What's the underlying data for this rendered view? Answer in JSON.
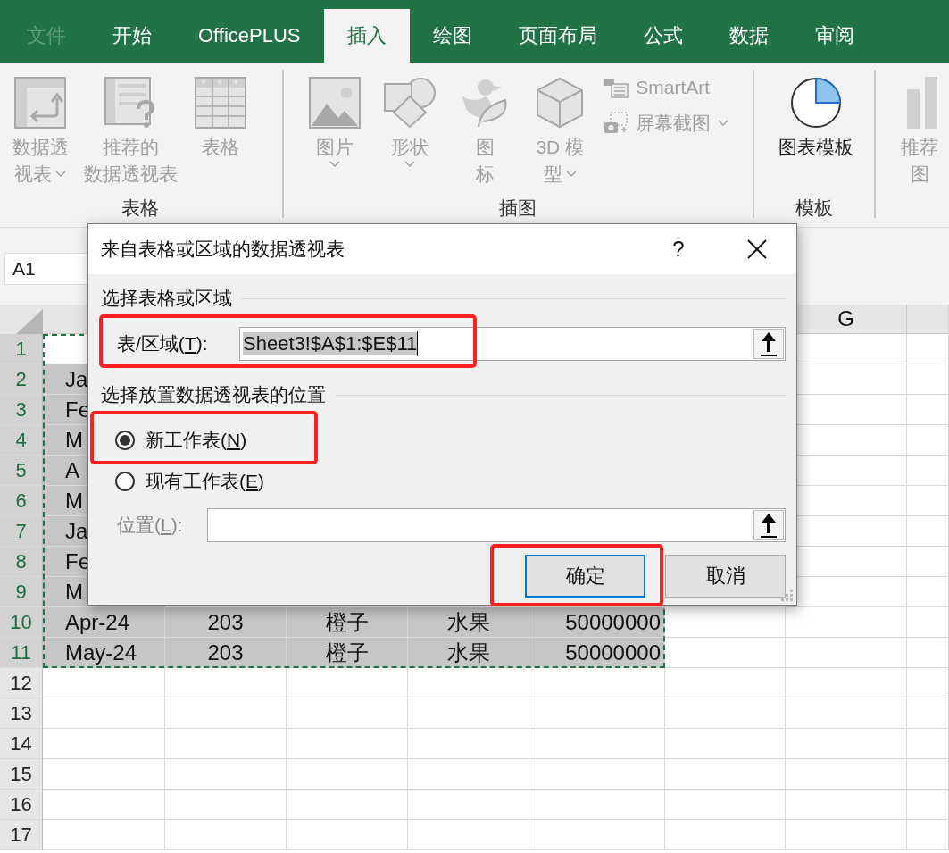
{
  "tabs": [
    {
      "label": "文件",
      "selected": false,
      "disabled": true
    },
    {
      "label": "开始",
      "selected": false,
      "disabled": false
    },
    {
      "label": "OfficePLUS",
      "selected": false,
      "disabled": false
    },
    {
      "label": "插入",
      "selected": true,
      "disabled": false
    },
    {
      "label": "绘图",
      "selected": false,
      "disabled": false
    },
    {
      "label": "页面布局",
      "selected": false,
      "disabled": false
    },
    {
      "label": "公式",
      "selected": false,
      "disabled": false
    },
    {
      "label": "数据",
      "selected": false,
      "disabled": false
    },
    {
      "label": "审阅",
      "selected": false,
      "disabled": false
    }
  ],
  "ribbon": {
    "groups": [
      {
        "label": "表格",
        "items": [
          {
            "kind": "large",
            "lines": [
              "数据透",
              "视表"
            ],
            "dropdown": true,
            "disabled": true
          },
          {
            "kind": "large",
            "lines": [
              "推荐的",
              "数据透视表"
            ],
            "dropdown": false,
            "disabled": true
          },
          {
            "kind": "large",
            "lines": [
              "表格"
            ],
            "dropdown": false,
            "disabled": true
          }
        ]
      },
      {
        "label": "插图",
        "items": [
          {
            "kind": "large",
            "lines": [
              "图片"
            ],
            "dropdown": true,
            "disabled": true
          },
          {
            "kind": "large",
            "lines": [
              "形状"
            ],
            "dropdown": true,
            "disabled": true
          },
          {
            "kind": "large",
            "lines": [
              "图",
              "标"
            ],
            "dropdown": false,
            "disabled": true
          },
          {
            "kind": "large",
            "lines": [
              "3D 模",
              "型"
            ],
            "dropdown": true,
            "disabled": true
          },
          {
            "kind": "stack",
            "items": [
              {
                "label": "SmartArt",
                "dropdown": false,
                "disabled": true
              },
              {
                "label": "屏幕截图",
                "dropdown": true,
                "disabled": true
              }
            ]
          }
        ]
      },
      {
        "label": "模板",
        "items": [
          {
            "kind": "large",
            "lines": [
              "图表模板"
            ],
            "dropdown": false,
            "disabled": false
          }
        ]
      },
      {
        "items": [
          {
            "kind": "large",
            "lines": [
              "推荐",
              "图"
            ],
            "dropdown": false,
            "disabled": true
          }
        ]
      }
    ]
  },
  "name_box": {
    "value": "A1"
  },
  "sheet": {
    "column_header": "G",
    "rows": [
      {
        "number": "1",
        "selected": true,
        "cells": [
          {
            "active": true
          }
        ]
      },
      {
        "number": "2",
        "selected": true,
        "cells": [
          {
            "text": "Ja",
            "active": false
          }
        ]
      },
      {
        "number": "3",
        "selected": true,
        "cells": [
          {
            "text": "Fe",
            "active": false
          }
        ]
      },
      {
        "number": "4",
        "selected": true,
        "cells": [
          {
            "text": "M",
            "active": false
          }
        ]
      },
      {
        "number": "5",
        "selected": true,
        "cells": [
          {
            "text": "A",
            "active": false
          }
        ]
      },
      {
        "number": "6",
        "selected": true,
        "cells": [
          {
            "text": "M",
            "active": false
          }
        ]
      },
      {
        "number": "7",
        "selected": true,
        "cells": [
          {
            "text": "Ja",
            "active": false
          }
        ]
      },
      {
        "number": "8",
        "selected": true,
        "cells": [
          {
            "text": "Fe",
            "active": false
          }
        ]
      },
      {
        "number": "9",
        "selected": true,
        "cells": [
          {
            "text": "M",
            "active": false
          }
        ]
      },
      {
        "number": "10",
        "selected": true,
        "cells": [
          {
            "text": "Apr-24",
            "active": false
          },
          {
            "text": "203",
            "active": false
          },
          {
            "text": "橙子",
            "active": false
          },
          {
            "text": "水果",
            "active": false
          },
          {
            "text": "50000000",
            "active": false
          }
        ]
      },
      {
        "number": "11",
        "selected": true,
        "cells": [
          {
            "text": "May-24",
            "active": false
          },
          {
            "text": "203",
            "active": false
          },
          {
            "text": "橙子",
            "active": false
          },
          {
            "text": "水果",
            "active": false
          },
          {
            "text": "50000000",
            "active": false
          }
        ]
      },
      {
        "number": "12",
        "selected": false
      },
      {
        "number": "13",
        "selected": false
      },
      {
        "number": "14",
        "selected": false
      },
      {
        "number": "15",
        "selected": false
      },
      {
        "number": "16",
        "selected": false
      },
      {
        "number": "17",
        "selected": false
      }
    ]
  },
  "dialog": {
    "title": "来自表格或区域的数据透视表",
    "help": "?",
    "source_heading": "选择表格或区域",
    "range_field": {
      "label": "表/区域(",
      "access_key": "T",
      "label_end": "):",
      "value": "Sheet3!$A$1:$E$11",
      "value_selected": true
    },
    "destination_heading": "选择放置数据透视表的位置",
    "destinations": [
      {
        "label": "新工作表(",
        "access_key": "N",
        "label_end": ")",
        "selected": true
      },
      {
        "label": "现有工作表(",
        "access_key": "E",
        "label_end": ")",
        "selected": false
      }
    ],
    "location_field": {
      "label": "位置(",
      "access_key": "L",
      "label_end": "):",
      "disabled": true
    },
    "buttons": [
      {
        "label": "确定",
        "focused": true
      },
      {
        "label": "取消",
        "focused": false
      }
    ]
  }
}
